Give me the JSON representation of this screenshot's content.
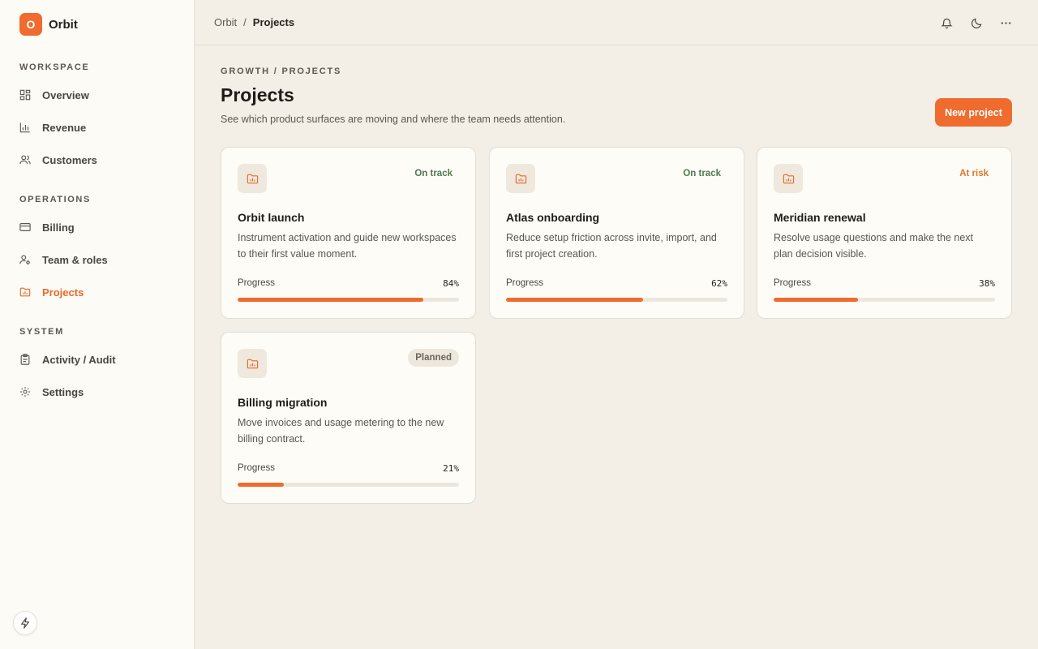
{
  "brand": {
    "logo_letter": "O",
    "name": "Orbit",
    "accent": "#ef6b2e"
  },
  "sidebar": {
    "sections": [
      {
        "title": "WORKSPACE",
        "items": [
          {
            "label": "Overview",
            "icon": "grid-icon"
          },
          {
            "label": "Revenue",
            "icon": "bar-chart-icon"
          },
          {
            "label": "Customers",
            "icon": "users-icon"
          }
        ]
      },
      {
        "title": "OPERATIONS",
        "items": [
          {
            "label": "Billing",
            "icon": "credit-card-icon"
          },
          {
            "label": "Team & roles",
            "icon": "user-cog-icon"
          },
          {
            "label": "Projects",
            "icon": "folder-chart-icon",
            "active": true
          }
        ]
      },
      {
        "title": "SYSTEM",
        "items": [
          {
            "label": "Activity / Audit",
            "icon": "clipboard-icon"
          },
          {
            "label": "Settings",
            "icon": "gear-icon"
          }
        ]
      }
    ]
  },
  "topbar": {
    "breadcrumb": {
      "root": "Orbit",
      "separator": "/",
      "current": "Projects"
    },
    "icons": [
      "bell-icon",
      "moon-icon",
      "more-horizontal-icon"
    ]
  },
  "main": {
    "eyebrow": "GROWTH / PROJECTS",
    "title": "Projects",
    "subtitle": "See which product surfaces are moving and where the team needs attention.",
    "new_button": "New project"
  },
  "projects": [
    {
      "title": "Orbit launch",
      "description": "Instrument activation and guide new workspaces to their first value moment.",
      "status": "On track",
      "status_kind": "on-track",
      "progress_label": "Progress",
      "progress": 84,
      "progress_text": "84%"
    },
    {
      "title": "Atlas onboarding",
      "description": "Reduce setup friction across invite, import, and first project creation.",
      "status": "On track",
      "status_kind": "on-track",
      "progress_label": "Progress",
      "progress": 62,
      "progress_text": "62%"
    },
    {
      "title": "Meridian renewal",
      "description": "Resolve usage questions and make the next plan decision visible.",
      "status": "At risk",
      "status_kind": "at-risk",
      "progress_label": "Progress",
      "progress": 38,
      "progress_text": "38%"
    },
    {
      "title": "Billing migration",
      "description": "Move invoices and usage metering to the new billing contract.",
      "status": "Planned",
      "status_kind": "planned",
      "progress_label": "Progress",
      "progress": 21,
      "progress_text": "21%"
    }
  ],
  "colors": {
    "accent": "#ef6b2e",
    "on_track": "#4d7a4f",
    "at_risk": "#d9782d",
    "planned_bg": "#ede7dc"
  }
}
